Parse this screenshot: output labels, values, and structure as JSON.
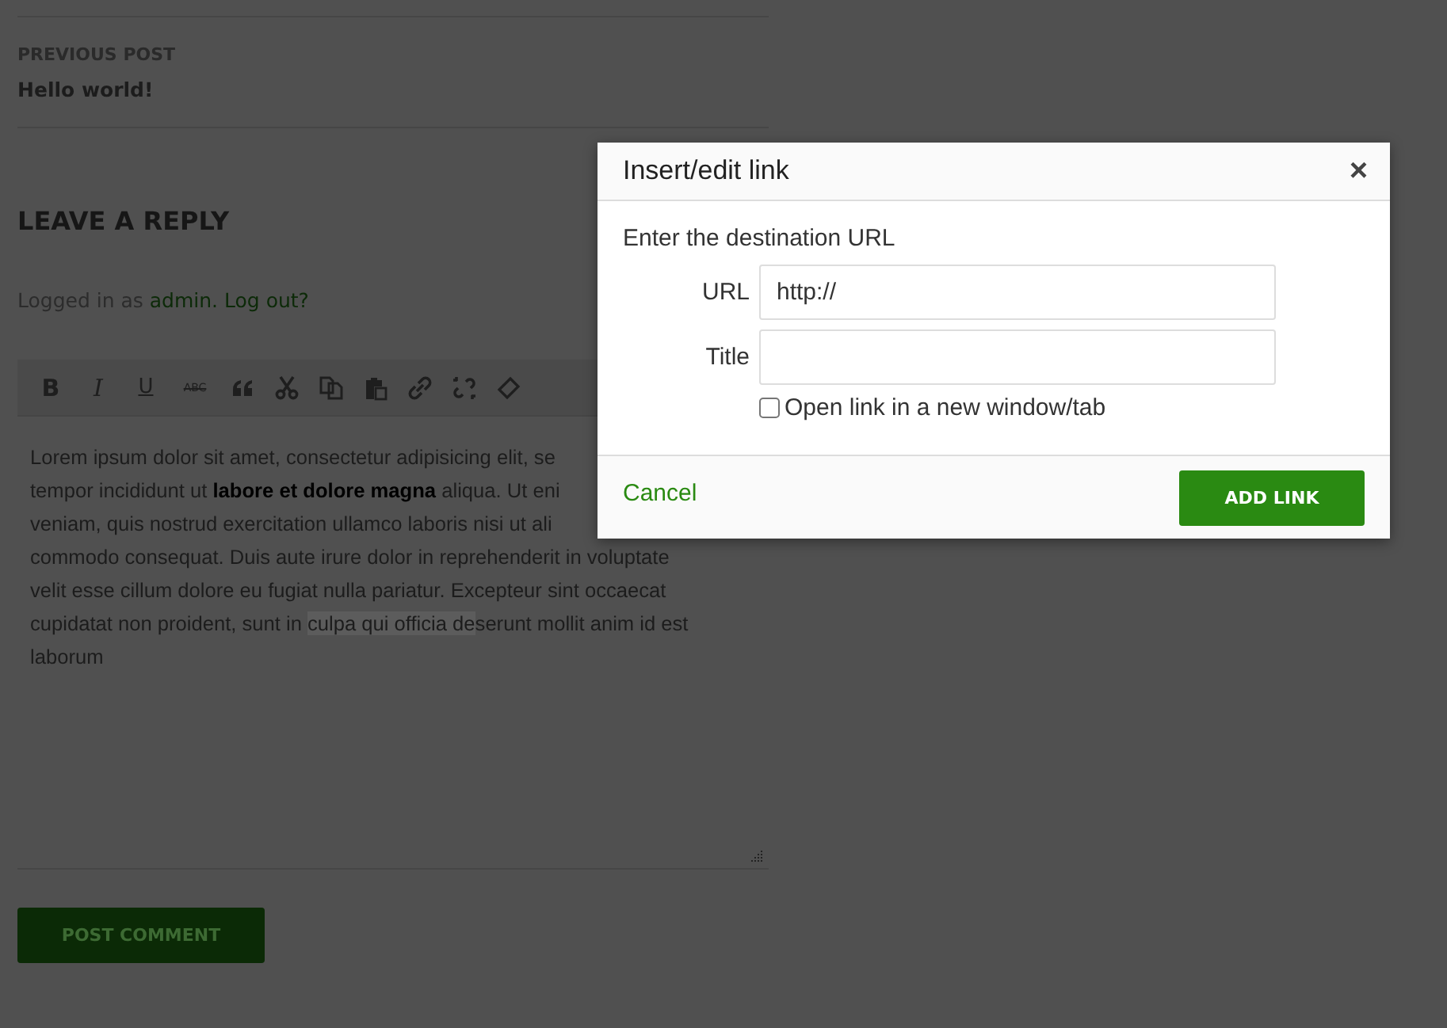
{
  "previous_post": {
    "label": "PREVIOUS POST",
    "title": "Hello world!"
  },
  "reply": {
    "heading": "LEAVE A REPLY",
    "logged_in_prefix": "Logged in as",
    "user_link": "admin.",
    "logout_link": "Log out?"
  },
  "toolbar": [
    {
      "kind": "bold",
      "label": "B"
    },
    {
      "kind": "italic",
      "label": "I"
    },
    {
      "kind": "underline",
      "label": "U"
    },
    {
      "kind": "strike",
      "label": "ABC"
    },
    {
      "kind": "quote"
    },
    {
      "kind": "cut"
    },
    {
      "kind": "copy"
    },
    {
      "kind": "paste"
    },
    {
      "kind": "link"
    },
    {
      "kind": "unlink"
    },
    {
      "kind": "eraser"
    }
  ],
  "editor_lines": [
    {
      "segments": [
        {
          "text": "Lorem ipsum dolor sit amet, consectetur adipisicing elit, se",
          "selected": false
        }
      ]
    },
    {
      "segments": [
        {
          "text": "tempor incididunt ut **labore et dolore magna** aliqua. Ut eni",
          "selected": false
        }
      ]
    },
    {
      "segments": [
        {
          "text": "veniam, quis nostrud exercitation ullamco laboris nisi ut ali",
          "selected": false
        }
      ]
    },
    {
      "segments": [
        {
          "text": "commodo consequat. Duis aute irure dolor in reprehenderit in voluptate",
          "selected": false
        }
      ]
    },
    {
      "segments": [
        {
          "text": "velit esse cillum dolore eu fugiat nulla pariatur. Excepteur sint occaecat",
          "selected": false
        }
      ]
    },
    {
      "segments": [
        {
          "text": "cupidatat non proident, sunt in ",
          "selected": false
        },
        {
          "text": "culpa qui officia de",
          "selected": true
        },
        {
          "text": "serunt mollit anim id est",
          "selected": false
        }
      ]
    },
    {
      "segments": [
        {
          "text": "laborum",
          "selected": false
        }
      ]
    }
  ],
  "submit_button": "POST COMMENT",
  "dialog": {
    "title": "Insert/edit link",
    "close": "×",
    "instruction": "Enter the destination URL",
    "fields": [
      {
        "label": "URL",
        "value": "http://"
      },
      {
        "label": "Title"
      }
    ],
    "new_window": {
      "label": "Open link in a new window/tab",
      "checked": false
    },
    "cancel": "Cancel",
    "submit": "ADD LINK"
  }
}
